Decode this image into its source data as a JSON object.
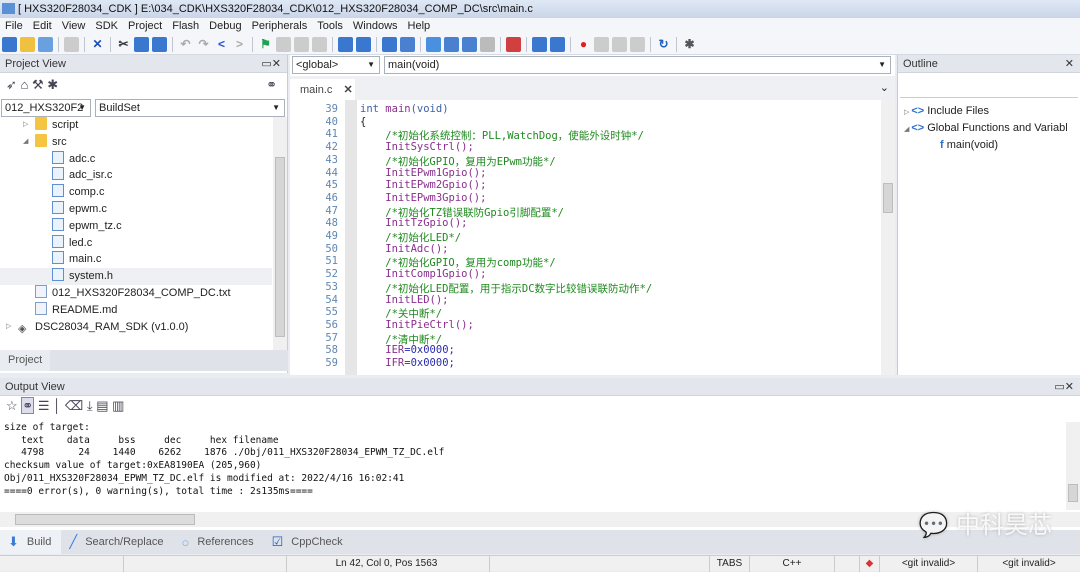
{
  "window": {
    "title": "[ HXS320F28034_CDK ] E:\\034_CDK\\HXS320F28034_CDK\\012_HXS320F28034_COMP_DC\\src\\main.c"
  },
  "menu": [
    "File",
    "Edit",
    "View",
    "SDK",
    "Project",
    "Flash",
    "Debug",
    "Peripherals",
    "Tools",
    "Windows",
    "Help"
  ],
  "project_view": {
    "title": "Project View",
    "project_select": "012_HXS320F2",
    "buildset_select": "BuildSet",
    "tree": [
      {
        "label": "script",
        "type": "folder",
        "indent": 1,
        "expander": "▷"
      },
      {
        "label": "src",
        "type": "folder",
        "indent": 1,
        "expander": "◢"
      },
      {
        "label": "adc.c",
        "type": "c",
        "indent": 2
      },
      {
        "label": "adc_isr.c",
        "type": "c",
        "indent": 2
      },
      {
        "label": "comp.c",
        "type": "c",
        "indent": 2
      },
      {
        "label": "epwm.c",
        "type": "c",
        "indent": 2
      },
      {
        "label": "epwm_tz.c",
        "type": "c",
        "indent": 2
      },
      {
        "label": "led.c",
        "type": "c",
        "indent": 2
      },
      {
        "label": "main.c",
        "type": "c",
        "indent": 2
      },
      {
        "label": "system.h",
        "type": "h",
        "indent": 2,
        "selected": true
      },
      {
        "label": "012_HXS320F28034_COMP_DC.txt",
        "type": "txt",
        "indent": 1
      },
      {
        "label": "README.md",
        "type": "txt",
        "indent": 1
      },
      {
        "label": "DSC28034_RAM_SDK (v1.0.0)",
        "type": "sdk",
        "indent": 0,
        "expander": "▷"
      }
    ],
    "bottom_tab": "Project"
  },
  "editor": {
    "scope_select": "<global>",
    "function_select": "main(void)",
    "tab": "main.c",
    "lines": [
      {
        "n": "39",
        "parts": [
          [
            "kw",
            "int "
          ],
          [
            "fn",
            "main"
          ],
          [
            "kw",
            "(void)"
          ]
        ]
      },
      {
        "n": "40",
        "parts": [
          [
            "",
            "{"
          ]
        ]
      },
      {
        "n": "41",
        "parts": [
          [
            "cm",
            "    /*初始化系统控制：PLL,WatchDog，使能外设时钟*/"
          ]
        ]
      },
      {
        "n": "42",
        "parts": [
          [
            "id",
            "    InitSysCtrl();"
          ]
        ]
      },
      {
        "n": "43",
        "parts": [
          [
            "cm",
            "    /*初始化GPIO，复用为EPwm功能*/"
          ]
        ]
      },
      {
        "n": "44",
        "parts": [
          [
            "id",
            "    InitEPwm1Gpio();"
          ]
        ]
      },
      {
        "n": "45",
        "parts": [
          [
            "id",
            "    InitEPwm2Gpio();"
          ]
        ]
      },
      {
        "n": "46",
        "parts": [
          [
            "id",
            "    InitEPwm3Gpio();"
          ]
        ]
      },
      {
        "n": "47",
        "parts": [
          [
            "cm",
            "    /*初始化TZ错误联防Gpio引脚配置*/"
          ]
        ]
      },
      {
        "n": "48",
        "parts": [
          [
            "id",
            "    InitTzGpio();"
          ]
        ]
      },
      {
        "n": "49",
        "parts": [
          [
            "cm",
            "    /*初始化LED*/"
          ]
        ]
      },
      {
        "n": "50",
        "parts": [
          [
            "id",
            "    InitAdc();"
          ]
        ]
      },
      {
        "n": "51",
        "parts": [
          [
            "cm",
            "    /*初始化GPIO，复用为comp功能*/"
          ]
        ]
      },
      {
        "n": "52",
        "parts": [
          [
            "id",
            "    InitComp1Gpio();"
          ]
        ]
      },
      {
        "n": "53",
        "parts": [
          [
            "cm",
            "    /*初始化LED配置，用于指示DC数字比较错误联防动作*/"
          ]
        ]
      },
      {
        "n": "54",
        "parts": [
          [
            "id",
            "    InitLED();"
          ]
        ]
      },
      {
        "n": "55",
        "parts": [
          [
            "cm",
            "    /*关中断*/"
          ]
        ]
      },
      {
        "n": "56",
        "parts": [
          [
            "id",
            "    InitPieCtrl();"
          ]
        ]
      },
      {
        "n": "57",
        "parts": [
          [
            "cm",
            "    /*清中断*/"
          ]
        ]
      },
      {
        "n": "58",
        "parts": [
          [
            "id",
            "    IER"
          ],
          [
            "nm",
            "=0x0000;"
          ]
        ]
      },
      {
        "n": "59",
        "parts": [
          [
            "id",
            "    IFR"
          ],
          [
            "nm",
            "=0x0000;"
          ]
        ]
      }
    ]
  },
  "outline": {
    "title": "Outline",
    "items": [
      {
        "label": "Include Files",
        "expander": "▷"
      },
      {
        "label": "Global Functions and Variabl",
        "expander": "◢"
      },
      {
        "label": "main(void)",
        "child": true
      }
    ]
  },
  "output_view": {
    "title": "Output View",
    "text": "size of target:\n   text    data     bss     dec     hex filename\n   4798      24    1440    6262    1876 ./Obj/011_HXS320F28034_EPWM_TZ_DC.elf\nchecksum value of target:0xEA8190EA (205,960)\nObj/011_HXS320F28034_EPWM_TZ_DC.elf is modified at: 2022/4/16 16:02:41\n====0 error(s), 0 warning(s), total time : 2s135ms===="
  },
  "bottom_tabs": [
    "Build",
    "Search/Replace",
    "References",
    "CppCheck"
  ],
  "status": {
    "position": "Ln 42, Col 0, Pos 1563",
    "indent": "TABS",
    "language": "C++",
    "git1": "<git invalid>",
    "git2": "<git invalid>"
  },
  "watermark": "中科昊芯"
}
